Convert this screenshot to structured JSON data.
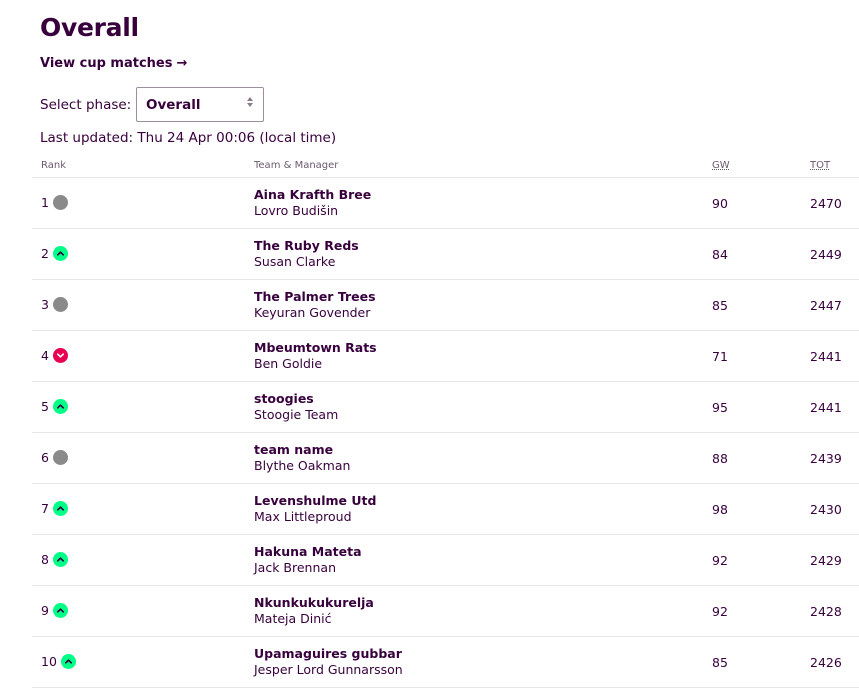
{
  "header": {
    "title": "Overall",
    "cup_link": "View cup matches",
    "cup_arrow": "→"
  },
  "phase": {
    "label": "Select phase:",
    "selected": "Overall"
  },
  "updated": "Last updated: Thu 24 Apr 00:06 (local time)",
  "table": {
    "columns": {
      "rank": "Rank",
      "team": "Team & Manager",
      "gw": "GW",
      "tot": "TOT"
    },
    "rows": [
      {
        "rank": "1",
        "movement": "same",
        "team": "Aina Krafth Bree",
        "manager": "Lovro Budišin",
        "gw": "90",
        "tot": "2470"
      },
      {
        "rank": "2",
        "movement": "up",
        "team": "The Ruby Reds",
        "manager": "Susan Clarke",
        "gw": "84",
        "tot": "2449"
      },
      {
        "rank": "3",
        "movement": "same",
        "team": "The Palmer Trees",
        "manager": "Keyuran Govender",
        "gw": "85",
        "tot": "2447"
      },
      {
        "rank": "4",
        "movement": "down",
        "team": "Mbeumtown Rats",
        "manager": "Ben Goldie",
        "gw": "71",
        "tot": "2441"
      },
      {
        "rank": "5",
        "movement": "up",
        "team": "stoogies",
        "manager": "Stoogie Team",
        "gw": "95",
        "tot": "2441"
      },
      {
        "rank": "6",
        "movement": "same",
        "team": "team name",
        "manager": "Blythe Oakman",
        "gw": "88",
        "tot": "2439"
      },
      {
        "rank": "7",
        "movement": "up",
        "team": "Levenshulme Utd",
        "manager": "Max Littleproud",
        "gw": "98",
        "tot": "2430"
      },
      {
        "rank": "8",
        "movement": "up",
        "team": "Hakuna Mateta",
        "manager": "Jack Brennan",
        "gw": "92",
        "tot": "2429"
      },
      {
        "rank": "9",
        "movement": "up",
        "team": "Nkunkukukurelja",
        "manager": "Mateja Dinić",
        "gw": "92",
        "tot": "2428"
      },
      {
        "rank": "10",
        "movement": "up",
        "team": "Upamaguires gubbar",
        "manager": "Jesper Lord Gunnarsson",
        "gw": "85",
        "tot": "2426"
      }
    ]
  },
  "colors": {
    "brand": "#37003c",
    "up": "#00ff87",
    "down": "#e90052",
    "same": "#8a8a8a"
  }
}
